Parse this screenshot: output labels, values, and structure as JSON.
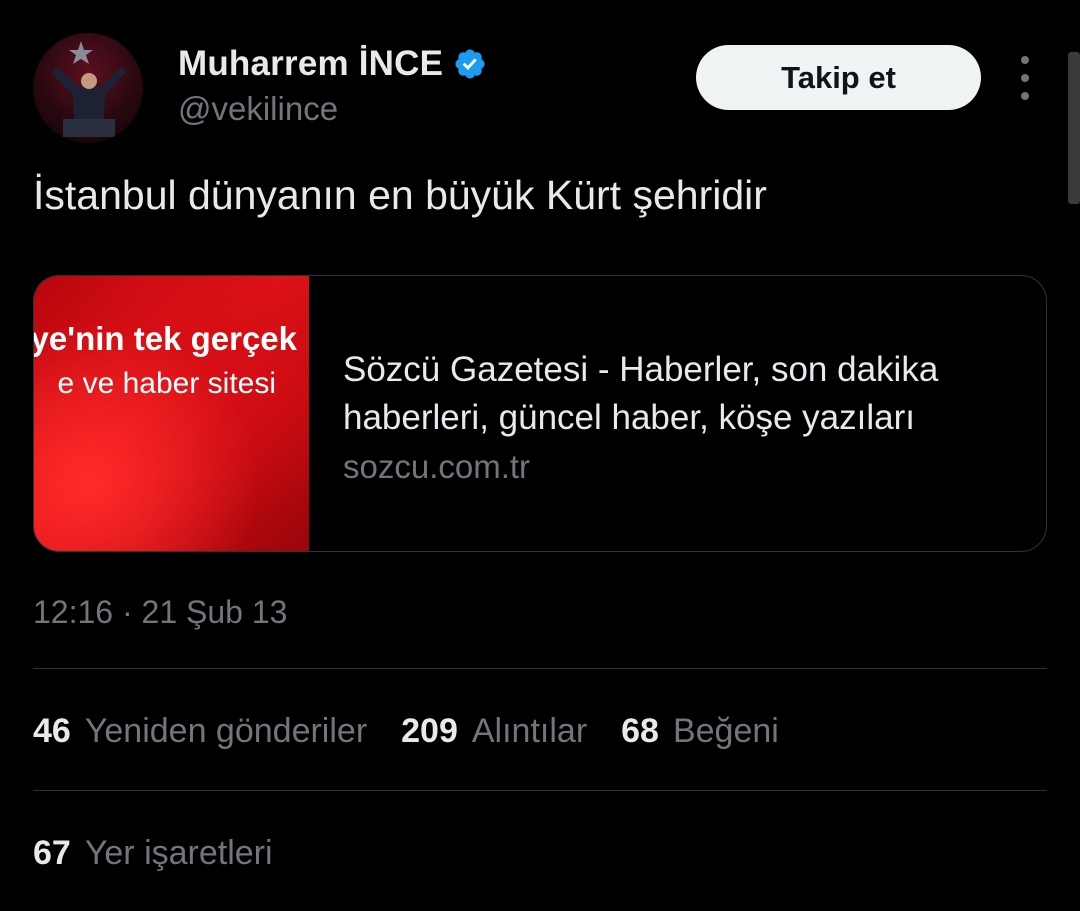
{
  "author": {
    "name": "Muharrem İNCE",
    "handle": "@vekilince",
    "verified_icon": "verified-badge-icon"
  },
  "follow_button": {
    "label": "Takip et"
  },
  "more_menu_icon": "more-vertical-icon",
  "tweet": {
    "text": "İstanbul dünyanın en büyük Kürt şehridir"
  },
  "link_card": {
    "thumbnail_text_line1": "ye'nin tek gerçek",
    "thumbnail_text_line2": "e ve haber sitesi",
    "title": "Sözcü Gazetesi - Haberler, son dakika haberleri, güncel haber, köşe yazıları",
    "domain": "sozcu.com.tr"
  },
  "timestamp": "12:16 · 21 Şub 13",
  "stats": {
    "retweets": {
      "count": "46",
      "label": "Yeniden gönderiler"
    },
    "quotes": {
      "count": "209",
      "label": "Alıntılar"
    },
    "likes": {
      "count": "68",
      "label": "Beğeni"
    },
    "bookmarks": {
      "count": "67",
      "label": "Yer işaretleri"
    }
  },
  "colors": {
    "background": "#000000",
    "primary_text": "#e7e9ea",
    "secondary_text": "#71767b",
    "verified_blue": "#1d9bf0",
    "divider": "#2f3336",
    "button_bg": "#eff3f4",
    "card_red": "#e11419"
  }
}
